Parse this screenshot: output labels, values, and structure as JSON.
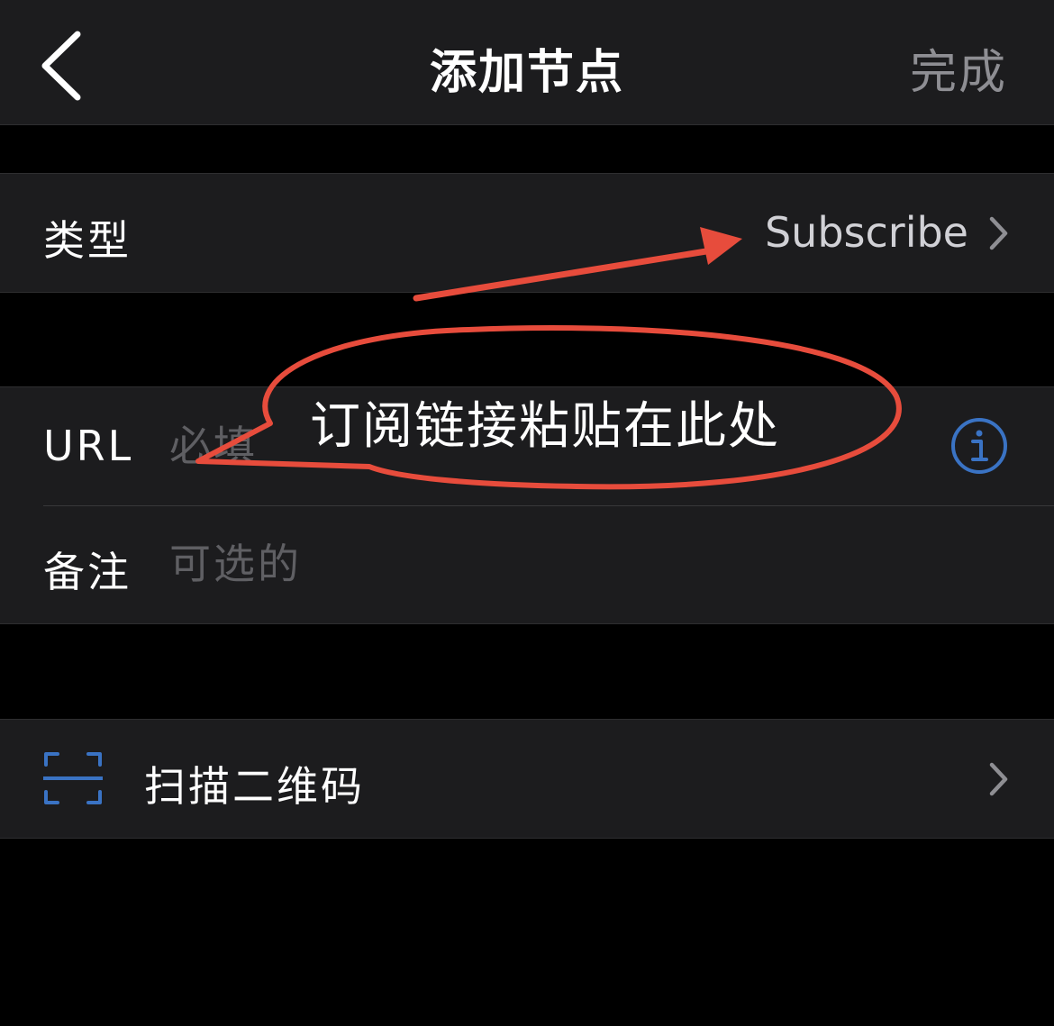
{
  "nav": {
    "title": "添加节点",
    "done_label": "完成",
    "back_icon": "chevron-left-icon"
  },
  "type_cell": {
    "label": "类型",
    "value": "Subscribe",
    "chevron_icon": "chevron-right-icon"
  },
  "url_cell": {
    "label": "URL",
    "placeholder": "必填",
    "value": "",
    "info_icon": "info-circle-icon"
  },
  "note_cell": {
    "label": "备注",
    "placeholder": "可选的",
    "value": ""
  },
  "scan_cell": {
    "label": "扫描二维码",
    "icon": "qr-scan-icon",
    "chevron_icon": "chevron-right-icon"
  },
  "annotation": {
    "text": "订阅链接粘贴在此处",
    "color": "#e74c3c"
  },
  "colors": {
    "background": "#000000",
    "cell_background": "#1c1c1e",
    "accent_blue": "#3a73c4",
    "placeholder": "#5f5f63",
    "secondary_text": "#8e8e93"
  }
}
